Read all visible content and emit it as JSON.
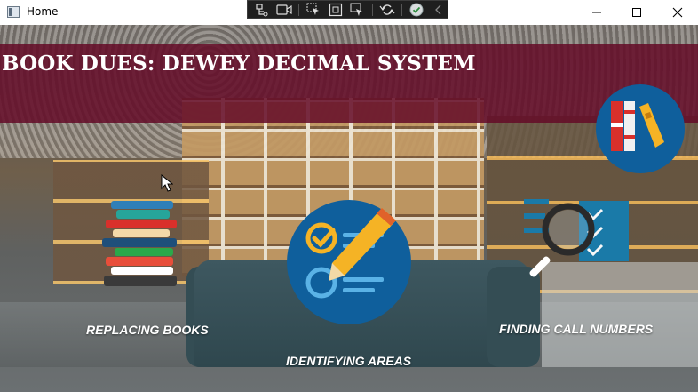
{
  "window": {
    "title": "Home",
    "controls": {
      "minimize": "minimize-icon",
      "maximize": "maximize-icon",
      "close": "close-icon"
    }
  },
  "debug_toolbar": {
    "tools": [
      {
        "name": "live-visual-tree-icon"
      },
      {
        "name": "record-icon"
      },
      {
        "name": "select-element-icon"
      },
      {
        "name": "display-layout-adorners-icon"
      },
      {
        "name": "track-focused-element-icon"
      },
      {
        "name": "hot-reload-icon"
      },
      {
        "name": "checkmark-icon"
      },
      {
        "name": "collapse-chevron-icon"
      }
    ]
  },
  "banner": {
    "title": "BOOK DUES: DEWEY DECIMAL SYSTEM",
    "logo": "bookshelf-logo-icon"
  },
  "tiles": [
    {
      "label": "REPLACING BOOKS",
      "icon": "book-stack-icon"
    },
    {
      "label": "IDENTIFYING AREAS",
      "icon": "checklist-pencil-icon"
    },
    {
      "label": "FINDING CALL NUMBERS",
      "icon": "magnifier-list-icon"
    }
  ],
  "colors": {
    "banner": "#640c28",
    "icon_blue": "#0f5f9c",
    "icon_yellow": "#f5b325",
    "icon_red": "#d9302b"
  }
}
